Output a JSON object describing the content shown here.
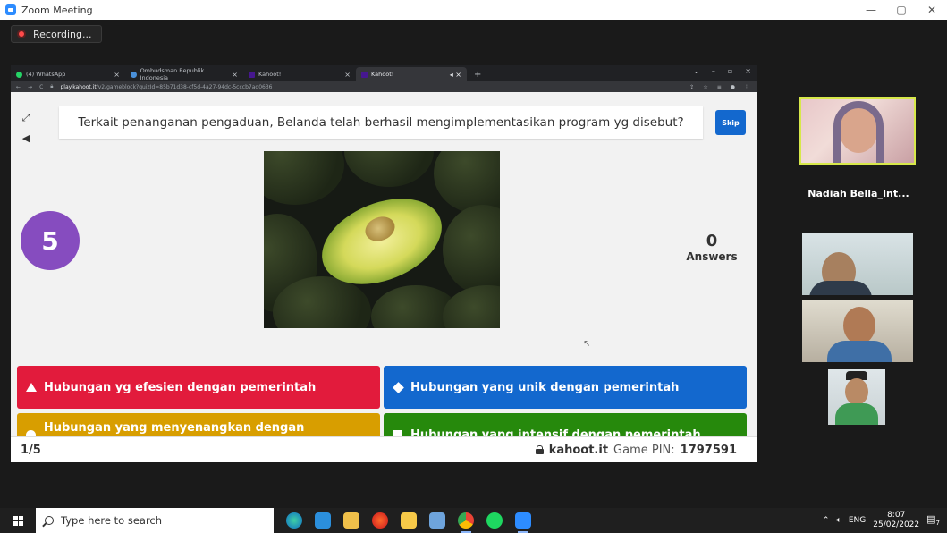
{
  "zoom": {
    "title": "Zoom Meeting",
    "recording": "Recording...",
    "window_controls": [
      "—",
      "▢",
      "✕"
    ]
  },
  "browser": {
    "tabs": [
      {
        "label": "(4) WhatsApp",
        "icon": "whatsapp-icon",
        "color": "#25d366"
      },
      {
        "label": "Ombudsman Republik Indonesia",
        "icon": "ombudsman-icon",
        "color": "#4a90d9"
      },
      {
        "label": "Kahoot!",
        "icon": "kahoot-icon",
        "color": "#46178f"
      },
      {
        "label": "Kahoot!",
        "icon": "kahoot-icon",
        "color": "#46178f",
        "active": true
      }
    ],
    "url_host": "play.kahoot.it",
    "url_path": "/v2/gameblock?quizId=85b71d38-cf5d-4a27-94dc-5cccb7ad0636"
  },
  "kahoot": {
    "question": "Terkait penanganan pengaduan, Belanda telah berhasil mengimplementasikan program yg disebut?",
    "skip_label": "Skip",
    "timer": "5",
    "answers_count": "0",
    "answers_label": "Answers",
    "options": [
      {
        "text": "Hubungan yg efesien dengan pemerintah",
        "shape": "triangle",
        "color": "#e21b3c"
      },
      {
        "text": "Hubungan yang unik dengan pemerintah",
        "shape": "diamond",
        "color": "#1368ce"
      },
      {
        "text": "Hubungan yang menyenangkan dengan pemerintah",
        "shape": "circle",
        "color": "#d89e00"
      },
      {
        "text": "Hubungan yang intensif dengan pemerintah",
        "shape": "square",
        "color": "#26890c"
      }
    ],
    "progress": "1/5",
    "brand": "kahoot.it",
    "pin_label": "Game PIN:",
    "pin": "1797591"
  },
  "participants": {
    "name_tile": "Nadiah  Bella_Int..."
  },
  "taskbar": {
    "search_placeholder": "Type here to search",
    "language": "ENG",
    "time": "8:07",
    "date": "25/02/2022",
    "notifications": "7"
  }
}
